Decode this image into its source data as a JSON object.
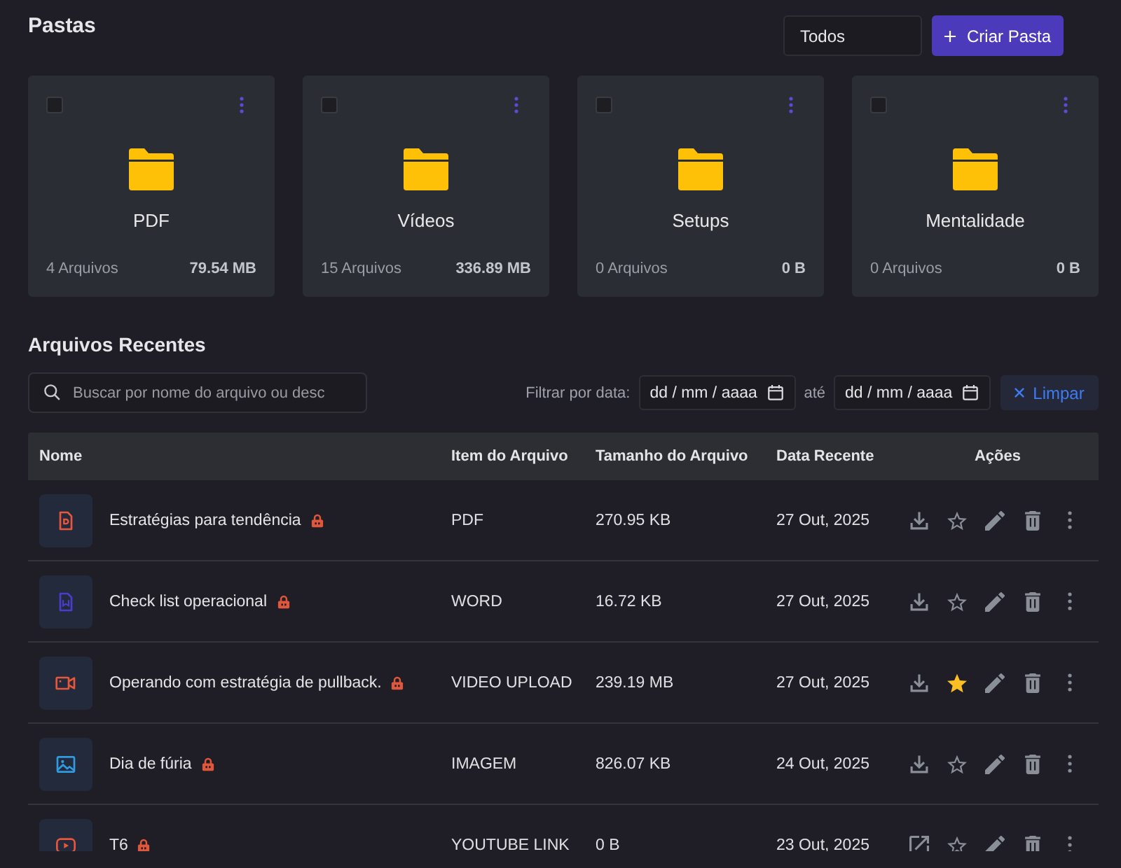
{
  "header": {
    "title": "Pastas",
    "filter": {
      "value": "Todos"
    },
    "create_button": {
      "label": "Criar Pasta"
    }
  },
  "folders": [
    {
      "name": "PDF",
      "count": "4 Arquivos",
      "size": "79.54 MB",
      "checked": false
    },
    {
      "name": "Vídeos",
      "count": "15 Arquivos",
      "size": "336.89 MB",
      "checked": false
    },
    {
      "name": "Setups",
      "count": "0 Arquivos",
      "size": "0 B",
      "checked": false
    },
    {
      "name": "Mentalidade",
      "count": "0 Arquivos",
      "size": "0 B",
      "checked": false
    }
  ],
  "recent": {
    "title": "Arquivos Recentes",
    "search": {
      "placeholder": "Buscar por nome do arquivo ou desc"
    },
    "date_filter": {
      "label": "Filtrar por data:",
      "from": {
        "placeholder": "dd / mm / aaaa"
      },
      "separator": "até",
      "to": {
        "placeholder": "dd / mm / aaaa"
      },
      "clear_button": {
        "label": "Limpar"
      }
    }
  },
  "table": {
    "columns": [
      "Nome",
      "Item do Arquivo",
      "Tamanho do Arquivo",
      "Data Recente",
      "Ações"
    ],
    "rows": [
      {
        "kind": "pdf",
        "name": "Estratégias para tendência",
        "locked": true,
        "type": "PDF",
        "size": "270.95 KB",
        "date": "27 Out, 2025",
        "favorite": false
      },
      {
        "kind": "word",
        "name": "Check list operacional",
        "locked": true,
        "type": "WORD",
        "size": "16.72 KB",
        "date": "27 Out, 2025",
        "favorite": false
      },
      {
        "kind": "video",
        "name": "Operando com estratégia de pullback.",
        "locked": true,
        "type": "VIDEO UPLOAD",
        "size": "239.19 MB",
        "date": "27 Out, 2025",
        "favorite": true
      },
      {
        "kind": "image",
        "name": "Dia de fúria",
        "locked": true,
        "type": "IMAGEM",
        "size": "826.07 KB",
        "date": "24 Out, 2025",
        "favorite": false
      },
      {
        "kind": "youtube",
        "name": "T6",
        "locked": true,
        "type": "YOUTUBE LINK",
        "size": "0 B",
        "date": "23 Out, 2025",
        "favorite": false
      }
    ]
  }
}
